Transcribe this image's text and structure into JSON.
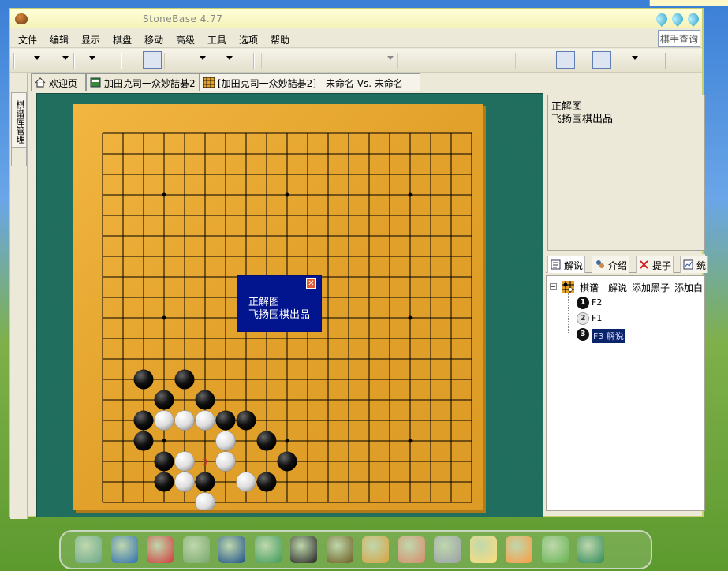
{
  "window": {
    "title": "StoneBase 4.77"
  },
  "menubar": {
    "items": [
      "文件",
      "编辑",
      "显示",
      "棋盘",
      "移动",
      "高级",
      "工具",
      "选项",
      "帮助"
    ],
    "search_button": "棋手查询"
  },
  "side_panel": {
    "tab_label": "棋谱库管理"
  },
  "tabs": [
    {
      "label": "欢迎页",
      "icon": "home-icon"
    },
    {
      "label": "加田克司一众妙詰碁2",
      "icon": "database-icon"
    },
    {
      "label": "[加田克司一众妙詰碁2] - 未命名 Vs. 未命名",
      "icon": "board-icon"
    }
  ],
  "board": {
    "size": 19,
    "stones_black": [
      [
        2,
        12
      ],
      [
        4,
        12
      ],
      [
        3,
        13
      ],
      [
        5,
        13
      ],
      [
        2,
        14
      ],
      [
        6,
        14
      ],
      [
        7,
        14
      ],
      [
        2,
        15
      ],
      [
        8,
        15
      ],
      [
        3,
        16
      ],
      [
        9,
        16
      ],
      [
        3,
        17
      ],
      [
        5,
        17
      ],
      [
        8,
        17
      ]
    ],
    "stones_white": [
      [
        3,
        14
      ],
      [
        4,
        14
      ],
      [
        5,
        14
      ],
      [
        6,
        15
      ],
      [
        4,
        16
      ],
      [
        6,
        16
      ],
      [
        4,
        17
      ],
      [
        7,
        17
      ],
      [
        5,
        18
      ]
    ],
    "last_move_marker": "3",
    "colors": {
      "board": "#e2a12a",
      "background": "#216d5d",
      "popup": "#03148f"
    }
  },
  "popup": {
    "line1": "正解图",
    "line2": "飞扬围棋出品",
    "close_icon": "close-icon"
  },
  "comment_panel": {
    "line1": "正解图",
    "line2": "飞扬围棋出品"
  },
  "right_tabs": [
    {
      "label": "解说",
      "icon": "comment-icon"
    },
    {
      "label": "介绍",
      "icon": "people-icon"
    },
    {
      "label": "提子",
      "icon": "capture-icon"
    },
    {
      "label": "统",
      "icon": "chart-icon"
    }
  ],
  "tree": {
    "root_label": "棋谱",
    "root_actions": [
      "解说",
      "添加黑子",
      "添加白"
    ],
    "nodes": [
      {
        "number": "1",
        "color": "black",
        "label": "F2",
        "selected": false
      },
      {
        "number": "2",
        "color": "white",
        "label": "F1",
        "selected": false
      },
      {
        "number": "3",
        "color": "black",
        "label": "F3  解说",
        "selected": true
      }
    ]
  },
  "dock": {
    "icons": [
      "desktop-icon",
      "monitor-icon",
      "mascot-icon",
      "notepad-icon",
      "media-icon",
      "network-icon",
      "qq-penguin-icon",
      "book-icon",
      "chart-window-icon",
      "paint-icon",
      "usb-icon",
      "calendar-icon",
      "cat-icon",
      "help-icon",
      "camera-icon"
    ]
  }
}
